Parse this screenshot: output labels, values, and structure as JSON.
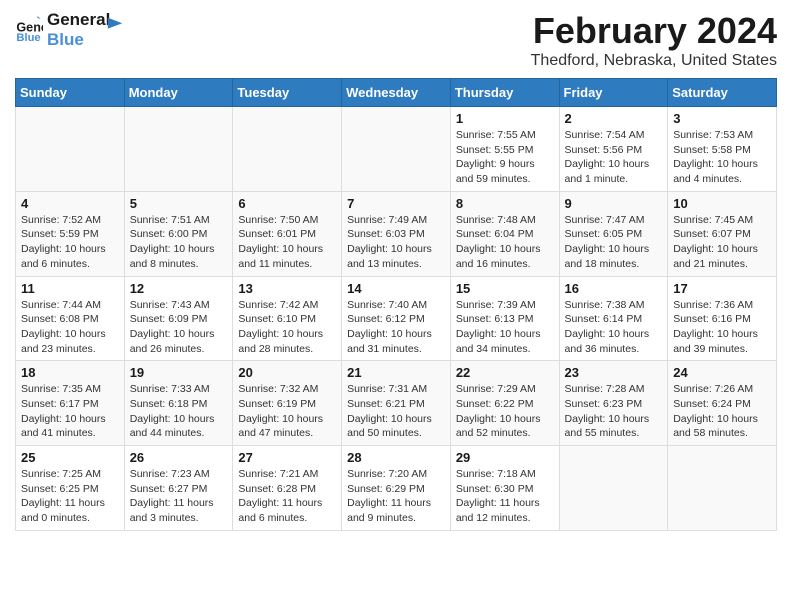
{
  "header": {
    "logo_line1": "General",
    "logo_line2": "Blue",
    "month_year": "February 2024",
    "location": "Thedford, Nebraska, United States"
  },
  "days_of_week": [
    "Sunday",
    "Monday",
    "Tuesday",
    "Wednesday",
    "Thursday",
    "Friday",
    "Saturday"
  ],
  "weeks": [
    {
      "cells": [
        {
          "empty": true
        },
        {
          "empty": true
        },
        {
          "empty": true
        },
        {
          "empty": true
        },
        {
          "day": 1,
          "sunrise": "7:55 AM",
          "sunset": "5:55 PM",
          "daylight": "9 hours and 59 minutes."
        },
        {
          "day": 2,
          "sunrise": "7:54 AM",
          "sunset": "5:56 PM",
          "daylight": "10 hours and 1 minute."
        },
        {
          "day": 3,
          "sunrise": "7:53 AM",
          "sunset": "5:58 PM",
          "daylight": "10 hours and 4 minutes."
        }
      ]
    },
    {
      "cells": [
        {
          "day": 4,
          "sunrise": "7:52 AM",
          "sunset": "5:59 PM",
          "daylight": "10 hours and 6 minutes."
        },
        {
          "day": 5,
          "sunrise": "7:51 AM",
          "sunset": "6:00 PM",
          "daylight": "10 hours and 8 minutes."
        },
        {
          "day": 6,
          "sunrise": "7:50 AM",
          "sunset": "6:01 PM",
          "daylight": "10 hours and 11 minutes."
        },
        {
          "day": 7,
          "sunrise": "7:49 AM",
          "sunset": "6:03 PM",
          "daylight": "10 hours and 13 minutes."
        },
        {
          "day": 8,
          "sunrise": "7:48 AM",
          "sunset": "6:04 PM",
          "daylight": "10 hours and 16 minutes."
        },
        {
          "day": 9,
          "sunrise": "7:47 AM",
          "sunset": "6:05 PM",
          "daylight": "10 hours and 18 minutes."
        },
        {
          "day": 10,
          "sunrise": "7:45 AM",
          "sunset": "6:07 PM",
          "daylight": "10 hours and 21 minutes."
        }
      ]
    },
    {
      "cells": [
        {
          "day": 11,
          "sunrise": "7:44 AM",
          "sunset": "6:08 PM",
          "daylight": "10 hours and 23 minutes."
        },
        {
          "day": 12,
          "sunrise": "7:43 AM",
          "sunset": "6:09 PM",
          "daylight": "10 hours and 26 minutes."
        },
        {
          "day": 13,
          "sunrise": "7:42 AM",
          "sunset": "6:10 PM",
          "daylight": "10 hours and 28 minutes."
        },
        {
          "day": 14,
          "sunrise": "7:40 AM",
          "sunset": "6:12 PM",
          "daylight": "10 hours and 31 minutes."
        },
        {
          "day": 15,
          "sunrise": "7:39 AM",
          "sunset": "6:13 PM",
          "daylight": "10 hours and 34 minutes."
        },
        {
          "day": 16,
          "sunrise": "7:38 AM",
          "sunset": "6:14 PM",
          "daylight": "10 hours and 36 minutes."
        },
        {
          "day": 17,
          "sunrise": "7:36 AM",
          "sunset": "6:16 PM",
          "daylight": "10 hours and 39 minutes."
        }
      ]
    },
    {
      "cells": [
        {
          "day": 18,
          "sunrise": "7:35 AM",
          "sunset": "6:17 PM",
          "daylight": "10 hours and 41 minutes."
        },
        {
          "day": 19,
          "sunrise": "7:33 AM",
          "sunset": "6:18 PM",
          "daylight": "10 hours and 44 minutes."
        },
        {
          "day": 20,
          "sunrise": "7:32 AM",
          "sunset": "6:19 PM",
          "daylight": "10 hours and 47 minutes."
        },
        {
          "day": 21,
          "sunrise": "7:31 AM",
          "sunset": "6:21 PM",
          "daylight": "10 hours and 50 minutes."
        },
        {
          "day": 22,
          "sunrise": "7:29 AM",
          "sunset": "6:22 PM",
          "daylight": "10 hours and 52 minutes."
        },
        {
          "day": 23,
          "sunrise": "7:28 AM",
          "sunset": "6:23 PM",
          "daylight": "10 hours and 55 minutes."
        },
        {
          "day": 24,
          "sunrise": "7:26 AM",
          "sunset": "6:24 PM",
          "daylight": "10 hours and 58 minutes."
        }
      ]
    },
    {
      "cells": [
        {
          "day": 25,
          "sunrise": "7:25 AM",
          "sunset": "6:25 PM",
          "daylight": "11 hours and 0 minutes."
        },
        {
          "day": 26,
          "sunrise": "7:23 AM",
          "sunset": "6:27 PM",
          "daylight": "11 hours and 3 minutes."
        },
        {
          "day": 27,
          "sunrise": "7:21 AM",
          "sunset": "6:28 PM",
          "daylight": "11 hours and 6 minutes."
        },
        {
          "day": 28,
          "sunrise": "7:20 AM",
          "sunset": "6:29 PM",
          "daylight": "11 hours and 9 minutes."
        },
        {
          "day": 29,
          "sunrise": "7:18 AM",
          "sunset": "6:30 PM",
          "daylight": "11 hours and 12 minutes."
        },
        {
          "empty": true
        },
        {
          "empty": true
        }
      ]
    }
  ],
  "labels": {
    "sunrise": "Sunrise:",
    "sunset": "Sunset:",
    "daylight": "Daylight:"
  }
}
